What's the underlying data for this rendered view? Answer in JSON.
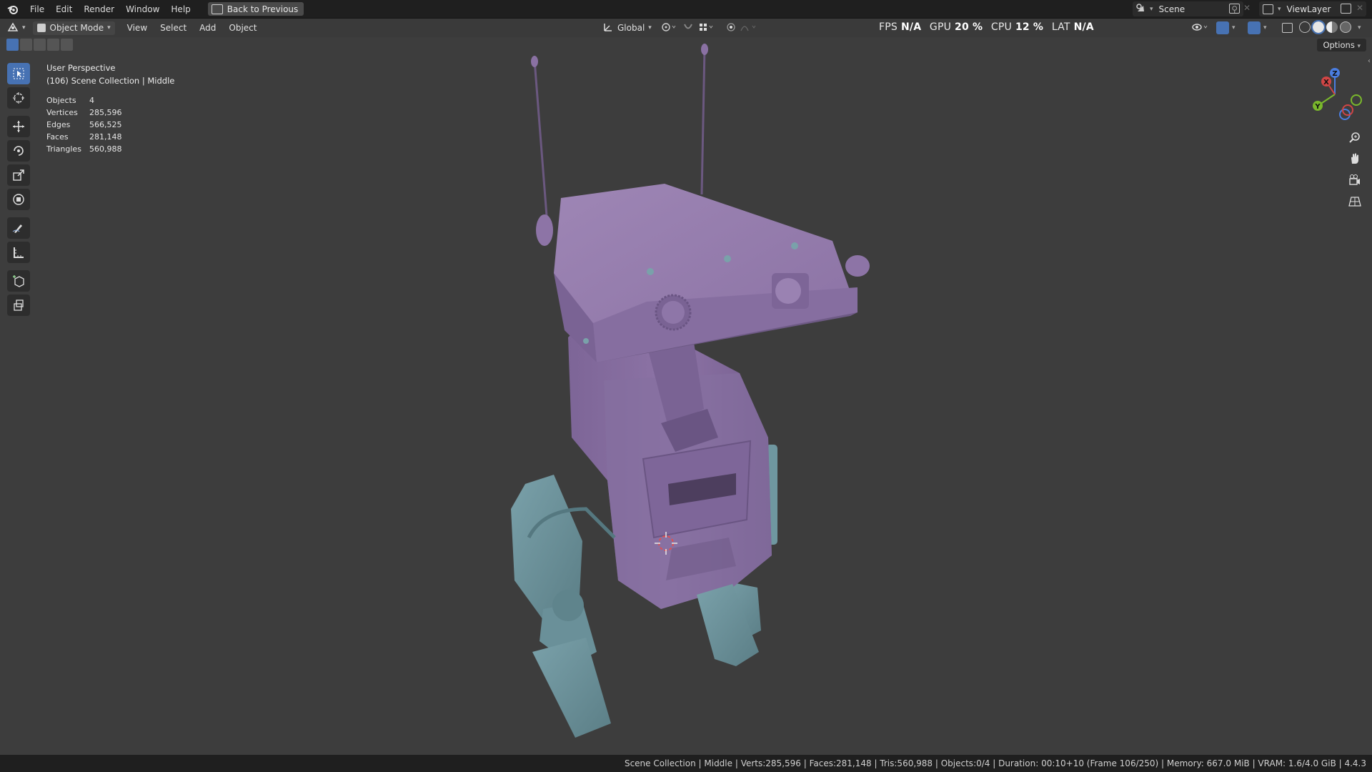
{
  "menubar": {
    "items": [
      "File",
      "Edit",
      "Render",
      "Window",
      "Help"
    ],
    "back_label": "Back to Previous",
    "scene_label": "Scene",
    "viewlayer_label": "ViewLayer"
  },
  "viewport_header": {
    "mode_label": "Object Mode",
    "menus": [
      "View",
      "Select",
      "Add",
      "Object"
    ],
    "transform_orientation": "Global"
  },
  "perf": {
    "fps_label": "FPS",
    "fps_value": "N/A",
    "gpu_label": "GPU",
    "gpu_value": "20 %",
    "cpu_label": "CPU",
    "cpu_value": "12 %",
    "lat_label": "LAT",
    "lat_value": "N/A"
  },
  "overlay": {
    "perspective": "User Perspective",
    "collection": "(106) Scene Collection | Middle"
  },
  "stats": [
    {
      "key": "Objects",
      "value": "4"
    },
    {
      "key": "Vertices",
      "value": "285,596"
    },
    {
      "key": "Edges",
      "value": "566,525"
    },
    {
      "key": "Faces",
      "value": "281,148"
    },
    {
      "key": "Triangles",
      "value": "560,988"
    }
  ],
  "options_label": "Options",
  "gizmo": {
    "x": "X",
    "y": "Y",
    "z": "Z"
  },
  "statusbar": {
    "text": "Scene Collection | Middle | Verts:285,596 | Faces:281,148 | Tris:560,988 | Objects:0/4 | Duration: 00:10+10 (Frame 106/250) | Memory: 667.0 MiB | VRAM: 1.6/4.0 GiB | 4.4.3"
  },
  "colors": {
    "body_purple": "#8f76a8",
    "body_purple_dark": "#6e5a85",
    "leg_teal": "#6f97a0",
    "leg_teal_dark": "#557880",
    "accent_blue": "#4772b3"
  }
}
